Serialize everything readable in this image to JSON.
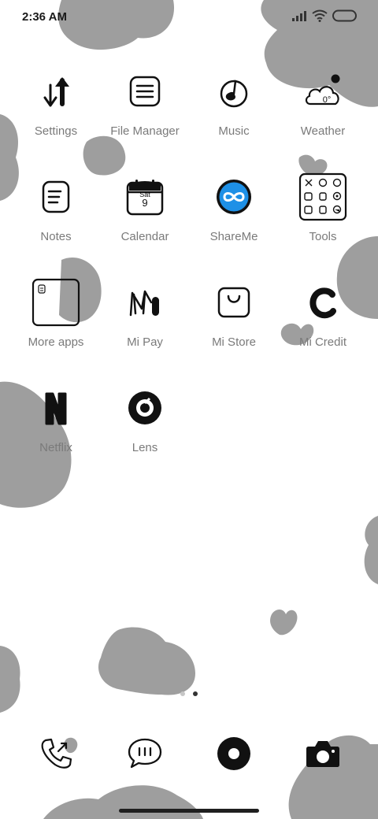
{
  "status_bar": {
    "time": "2:36 AM"
  },
  "apps": [
    {
      "label": "Settings",
      "icon": "settings-arrows-icon"
    },
    {
      "label": "File Manager",
      "icon": "file-manager-icon"
    },
    {
      "label": "Music",
      "icon": "music-note-icon"
    },
    {
      "label": "Weather",
      "icon": "weather-cloud-icon",
      "badge_text": "0°"
    },
    {
      "label": "Notes",
      "icon": "notes-icon"
    },
    {
      "label": "Calendar",
      "icon": "calendar-icon",
      "day": "Sat",
      "date": "9"
    },
    {
      "label": "ShareMe",
      "icon": "shareme-infinity-icon"
    },
    {
      "label": "Tools",
      "icon": "tools-folder-icon"
    },
    {
      "label": "More apps",
      "icon": "more-apps-folder-icon"
    },
    {
      "label": "Mi Pay",
      "icon": "mi-pay-icon"
    },
    {
      "label": "Mi Store",
      "icon": "mi-store-bag-icon"
    },
    {
      "label": "Mi Credit",
      "icon": "mi-credit-icon"
    },
    {
      "label": "Netflix",
      "icon": "netflix-n-icon"
    },
    {
      "label": "Lens",
      "icon": "lens-icon"
    }
  ],
  "dock": [
    {
      "name": "phone",
      "icon": "phone-icon"
    },
    {
      "name": "messages",
      "icon": "messages-bubble-icon"
    },
    {
      "name": "browser",
      "icon": "browser-circle-icon"
    },
    {
      "name": "camera",
      "icon": "camera-icon"
    }
  ],
  "page_indicator": {
    "pages": 2,
    "current": 2
  },
  "colors": {
    "background": "#ffffff",
    "wallpaper_shapes": "#9e9e9e",
    "label": "#7a7a7a",
    "shareme_blue": "#1e90e6"
  }
}
